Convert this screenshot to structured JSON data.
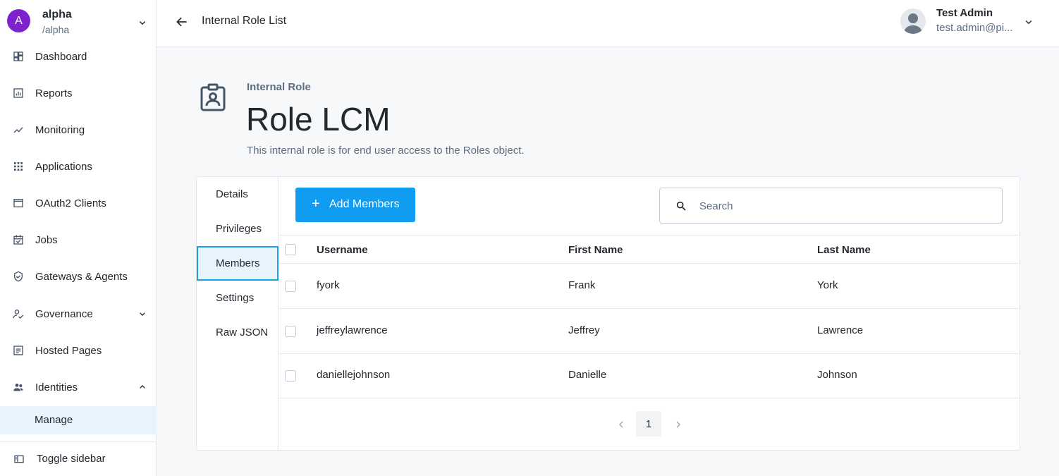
{
  "realm": {
    "avatar_letter": "A",
    "name": "alpha",
    "path": "/alpha"
  },
  "sidebar": {
    "items": [
      {
        "label": "Dashboard",
        "icon": "dashboard-icon"
      },
      {
        "label": "Reports",
        "icon": "reports-icon"
      },
      {
        "label": "Monitoring",
        "icon": "monitoring-icon"
      },
      {
        "label": "Applications",
        "icon": "applications-icon"
      },
      {
        "label": "OAuth2 Clients",
        "icon": "oauth2-icon"
      },
      {
        "label": "Jobs",
        "icon": "jobs-icon"
      },
      {
        "label": "Gateways & Agents",
        "icon": "shield-icon"
      },
      {
        "label": "Governance",
        "icon": "governance-icon"
      },
      {
        "label": "Hosted Pages",
        "icon": "hosted-pages-icon"
      },
      {
        "label": "Identities",
        "icon": "identities-icon"
      }
    ],
    "sub_item": "Manage",
    "toggle_label": "Toggle sidebar"
  },
  "header": {
    "title": "Internal Role List",
    "user_name": "Test Admin",
    "user_email": "test.admin@pi..."
  },
  "page": {
    "overline": "Internal Role",
    "title": "Role LCM",
    "subtitle": "This internal role is for end user access to the Roles object."
  },
  "tabs": [
    "Details",
    "Privileges",
    "Members",
    "Settings",
    "Raw JSON"
  ],
  "active_tab": "Members",
  "toolbar": {
    "add_label": "Add Members",
    "search_placeholder": "Search"
  },
  "table": {
    "columns": [
      "Username",
      "First Name",
      "Last Name"
    ],
    "rows": [
      [
        "fyork",
        "Frank",
        "York"
      ],
      [
        "jeffreylawrence",
        "Jeffrey",
        "Lawrence"
      ],
      [
        "daniellejohnson",
        "Danielle",
        "Johnson"
      ]
    ]
  },
  "pagination": {
    "current_page": "1"
  },
  "colors": {
    "accent": "#109cf1",
    "realm_avatar": "#7e22ce",
    "active_bg": "#e8f4fd"
  }
}
